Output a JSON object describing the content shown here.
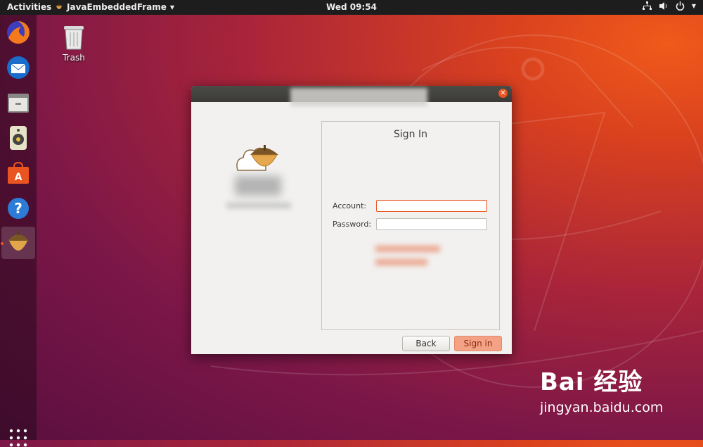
{
  "topbar": {
    "activities": "Activities",
    "app_name": "JavaEmbeddedFrame",
    "clock": "Wed 09:54"
  },
  "dock": {
    "items": [
      "firefox-icon",
      "thunderbird-icon",
      "files-icon",
      "rhythmbox-icon",
      "software-icon",
      "help-icon",
      "acorn-app-icon"
    ],
    "show_apps": "apps-grid-icon"
  },
  "desktop": {
    "trash_label": "Trash"
  },
  "dialog": {
    "close_glyph": "✕",
    "panel_title": "Sign In",
    "account_label": "Account:",
    "account_value": "",
    "password_label": "Password:",
    "password_value": "",
    "back_label": "Back",
    "signin_label": "Sign in"
  },
  "watermark": {
    "brand": "Bai  经验",
    "url": "jingyan.baidu.com"
  },
  "colors": {
    "accent": "#e95420",
    "topbar": "#1d1d1d",
    "dialog_bg": "#f2f1f0"
  }
}
